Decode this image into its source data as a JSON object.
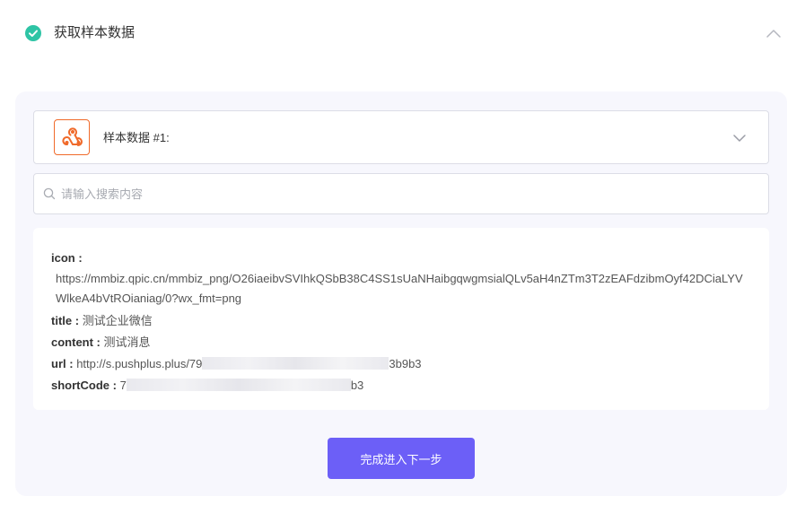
{
  "step": {
    "title": "获取样本数据",
    "status_color": "#2ec4a5",
    "collapse_icon": "chevron-up-icon"
  },
  "sample_selector": {
    "label": "样本数据 #1:",
    "app_icon": "webhook-icon",
    "app_icon_color": "#f06a2a",
    "dropdown_icon": "chevron-down-icon"
  },
  "search": {
    "placeholder": "请输入搜索内容",
    "value": ""
  },
  "sample": {
    "fields": [
      {
        "key": "icon :",
        "value": "https://mmbiz.qpic.cn/mmbiz_png/O26iaeibvSVIhkQSbB38C4SS1sUaNHaibgqwgmsialQLv5aH4nZTm3T2zEAFdzibmOyf42DCiaLYVWlkeA4bVtROianiag/0?wx_fmt=png"
      },
      {
        "key": "title :",
        "value": "测试企业微信"
      },
      {
        "key": "content :",
        "value": "测试消息"
      },
      {
        "key": "url :",
        "value_prefix": "http://s.pushplus.plus/79",
        "value_suffix": "3b9b3"
      },
      {
        "key": "shortCode :",
        "value_prefix": "7",
        "value_suffix": "b3"
      }
    ]
  },
  "actions": {
    "next_label": "完成进入下一步",
    "accent_color": "#6c5ff7"
  }
}
